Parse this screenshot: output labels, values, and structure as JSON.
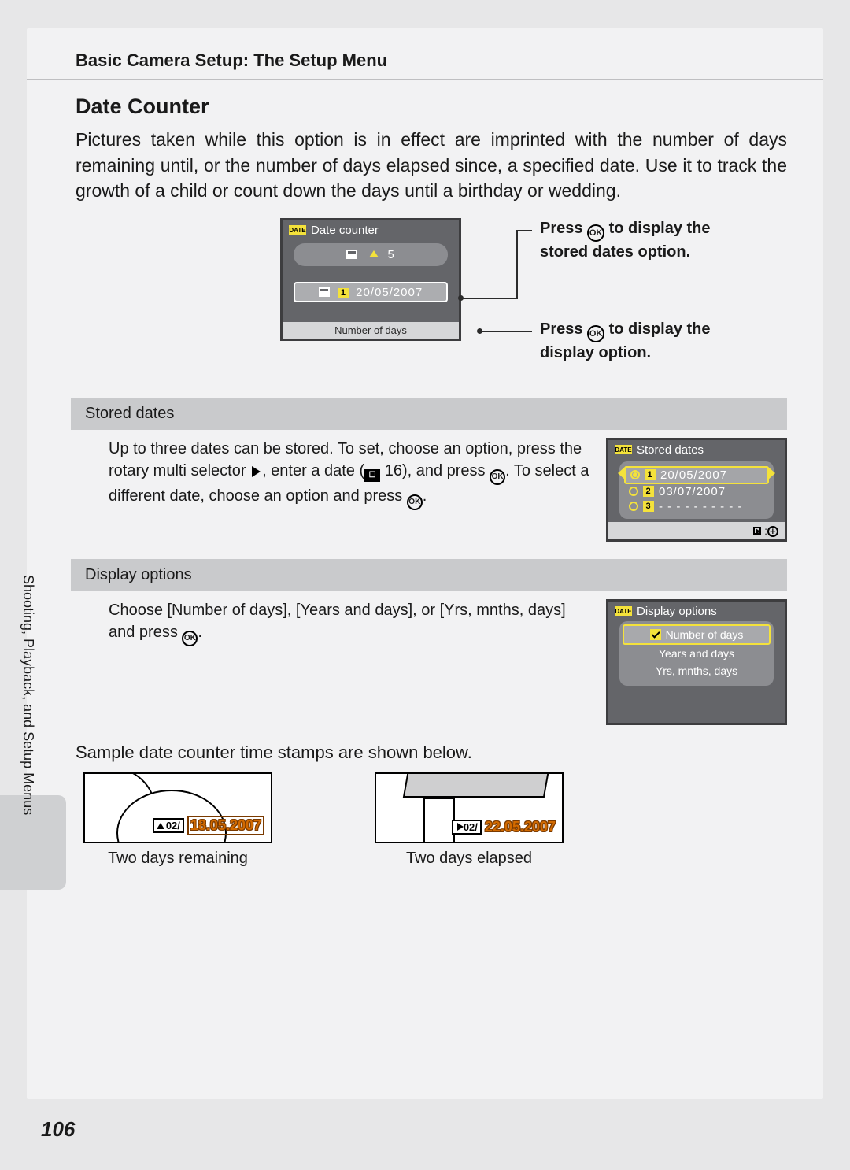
{
  "breadcrumb": "Basic Camera Setup: The Setup Menu",
  "heading": "Date Counter",
  "intro": "Pictures taken while this option is in effect are imprinted with the number of days remaining until, or the number of days elapsed since, a specified date. Use it to track the growth of a child or count down the days until a birthday or wedding.",
  "lcd_main": {
    "title": "Date counter",
    "mid_count": "5",
    "date": "20/05/2007",
    "slot": "1",
    "footer": "Number of days"
  },
  "callouts": {
    "stored": "Press ⓚ to display the stored dates option.",
    "display": "Press ⓚ to display the display option."
  },
  "sections": {
    "stored": {
      "band": "Stored dates",
      "para_a": "Up to three dates can be stored. To set, choose an option, press the rotary multi selector ",
      "para_b": ", enter a date (",
      "para_c": " 16), and press ",
      "para_d": ". To select a different date, choose an option and press ",
      "para_e": ".",
      "lcd_title": "Stored dates",
      "rows": [
        {
          "slot": "1",
          "date": "20/05/2007",
          "selected": true
        },
        {
          "slot": "2",
          "date": "03/07/2007",
          "selected": false
        },
        {
          "slot": "3",
          "date": "- - - - - - - - - -",
          "selected": false
        }
      ]
    },
    "display": {
      "band": "Display options",
      "para": "Choose [Number of days], [Years and days], or [Yrs, mnths, days] and press ",
      "para_end": ".",
      "lcd_title": "Display options",
      "options": [
        "Number of days",
        "Years and days",
        "Yrs, mnths, days"
      ]
    }
  },
  "icons": {
    "date_badge": "DATE",
    "ok_label": "OK"
  },
  "samples_intro": "Sample date counter time stamps are shown below.",
  "samples": [
    {
      "counter": "02/",
      "date": "18.05.2007",
      "caption": "Two days remaining",
      "dir": "up"
    },
    {
      "counter": "02/",
      "date": "22.05.2007",
      "caption": "Two days elapsed",
      "dir": "right"
    }
  ],
  "side_label": "Shooting, Playback, and Setup Menus",
  "page_number": "106"
}
